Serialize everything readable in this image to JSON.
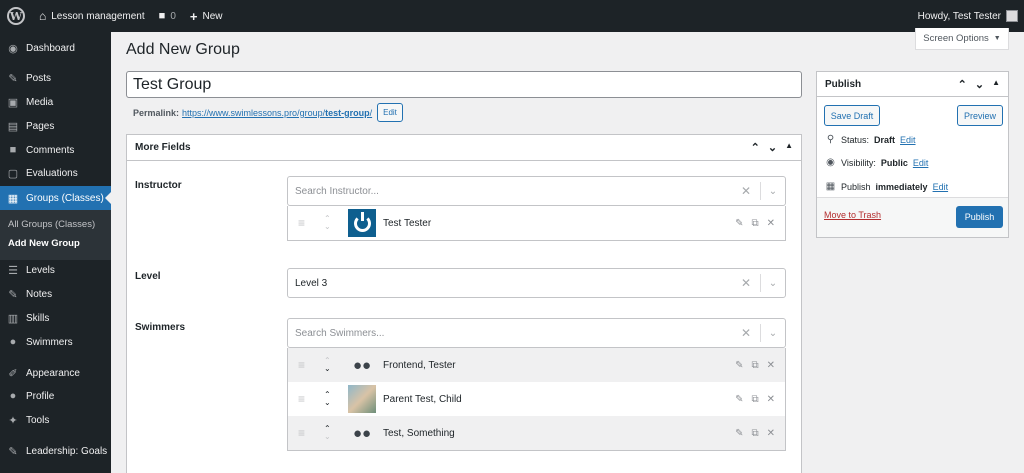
{
  "adminbar": {
    "site_name": "Lesson management",
    "comments_count": "0",
    "new_label": "New",
    "howdy": "Howdy, Test Tester"
  },
  "sidebar": {
    "items": [
      {
        "label": "Dashboard",
        "icon": "dashboard-icon"
      },
      {
        "label": "Posts",
        "icon": "pin-icon"
      },
      {
        "label": "Media",
        "icon": "media-icon"
      },
      {
        "label": "Pages",
        "icon": "page-icon"
      },
      {
        "label": "Comments",
        "icon": "comment-icon"
      },
      {
        "label": "Evaluations",
        "icon": "evaluation-icon"
      },
      {
        "label": "Groups (Classes)",
        "icon": "groups-icon"
      },
      {
        "label": "Levels",
        "icon": "list-icon"
      },
      {
        "label": "Notes",
        "icon": "pin-icon"
      },
      {
        "label": "Skills",
        "icon": "book-icon"
      },
      {
        "label": "Swimmers",
        "icon": "people-icon"
      },
      {
        "label": "Appearance",
        "icon": "brush-icon"
      },
      {
        "label": "Profile",
        "icon": "user-icon"
      },
      {
        "label": "Tools",
        "icon": "wrench-icon"
      },
      {
        "label": "Leadership: Goals",
        "icon": "pin-icon"
      }
    ],
    "submenu": [
      "All Groups (Classes)",
      "Add New Group"
    ]
  },
  "screen_options": "Screen Options",
  "page_title": "Add New Group",
  "post_title": "Test Group",
  "permalink": {
    "label": "Permalink:",
    "url_base": "https://www.swimlessons.pro/group/",
    "slug": "test-group",
    "url_end": "/",
    "edit": "Edit"
  },
  "more_fields": {
    "title": "More Fields",
    "instructor": {
      "label": "Instructor",
      "placeholder": "Search Instructor...",
      "items": [
        {
          "name": "Test Tester"
        }
      ]
    },
    "level": {
      "label": "Level",
      "value": "Level 3"
    },
    "swimmers": {
      "label": "Swimmers",
      "placeholder": "Search Swimmers...",
      "items": [
        {
          "name": "Frontend, Tester"
        },
        {
          "name": "Parent Test, Child"
        },
        {
          "name": "Test, Something"
        }
      ]
    }
  },
  "publish": {
    "title": "Publish",
    "save_draft": "Save Draft",
    "preview": "Preview",
    "status_label": "Status:",
    "status_value": "Draft",
    "visibility_label": "Visibility:",
    "visibility_value": "Public",
    "publish_label": "Publish",
    "publish_value": "immediately",
    "edit": "Edit",
    "trash": "Move to Trash",
    "publish_button": "Publish"
  },
  "colors": {
    "accent": "#2271b1",
    "adminbar": "#1d2327",
    "trash": "#b32d2e"
  }
}
